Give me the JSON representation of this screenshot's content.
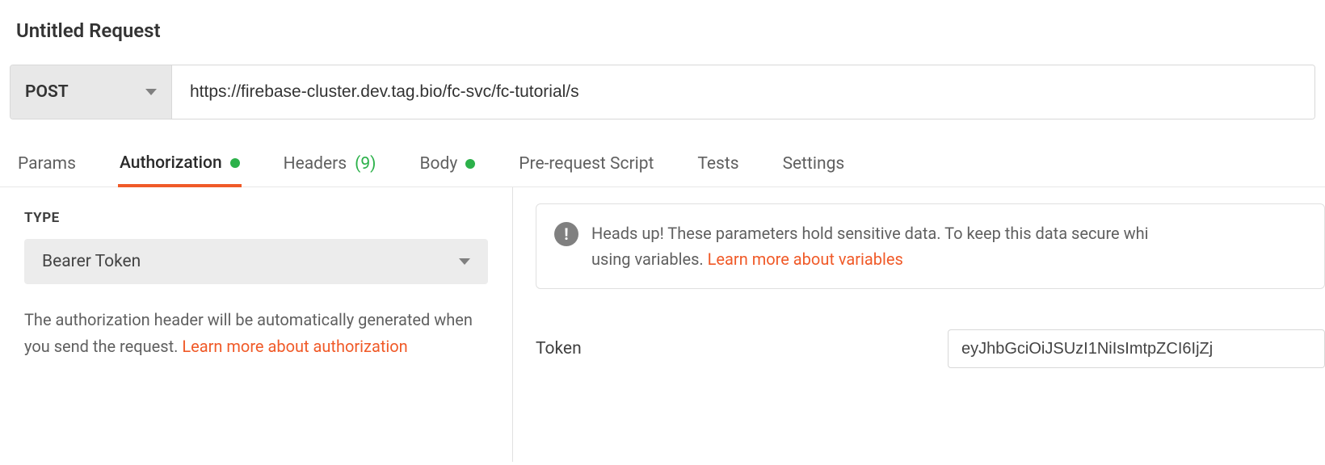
{
  "request": {
    "title": "Untitled Request",
    "method": "POST",
    "url": "https://firebase-cluster.dev.tag.bio/fc-svc/fc-tutorial/s"
  },
  "tabs": {
    "params": "Params",
    "authorization": "Authorization",
    "headers": "Headers",
    "headers_count": "(9)",
    "body": "Body",
    "prerequest": "Pre-request Script",
    "tests": "Tests",
    "settings": "Settings"
  },
  "auth": {
    "type_label": "TYPE",
    "type_value": "Bearer Token",
    "help_text_1": "The authorization header will be automatically generated when you send the request. ",
    "help_link": "Learn more about authorization"
  },
  "warning": {
    "text_1": "Heads up! These parameters hold sensitive data. To keep this data secure whi",
    "text_2": "using variables. ",
    "link": "Learn more about variables"
  },
  "token": {
    "label": "Token",
    "value": "eyJhbGciOiJSUzI1NiIsImtpZCI6IjZj"
  }
}
